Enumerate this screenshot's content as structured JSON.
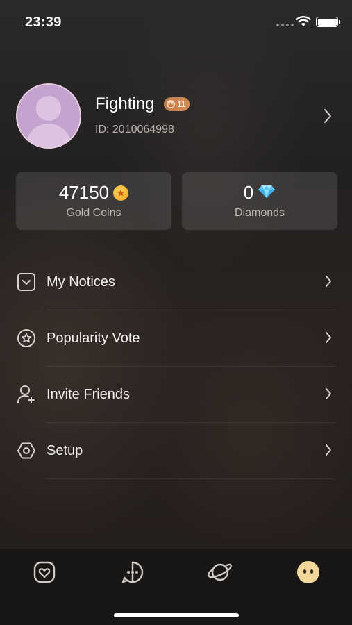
{
  "status_bar": {
    "time": "23:39"
  },
  "profile": {
    "name": "Fighting",
    "level": "11",
    "user_id": "ID: 2010064998"
  },
  "wallet": {
    "gold": {
      "value": "47150",
      "label": "Gold Coins",
      "icon": "coin-icon"
    },
    "diamonds": {
      "value": "0",
      "label": "Diamonds",
      "icon": "diamond-icon"
    }
  },
  "menu": {
    "items": [
      {
        "label": "My Notices",
        "icon": "notice-icon"
      },
      {
        "label": "Popularity Vote",
        "icon": "star-icon"
      },
      {
        "label": "Invite Friends",
        "icon": "add-user-icon"
      },
      {
        "label": "Setup",
        "icon": "settings-icon"
      }
    ]
  },
  "tab_bar": {
    "tabs": [
      {
        "icon": "heart-icon",
        "selected": false
      },
      {
        "icon": "chat-icon",
        "selected": false
      },
      {
        "icon": "planet-icon",
        "selected": false
      },
      {
        "icon": "profile-face-icon",
        "selected": true
      }
    ]
  },
  "colors": {
    "accent_gold": "#f1a51d",
    "badge": "#c07a4a",
    "diamond": "#7fd6ff",
    "selected_tab": "#f3d79a"
  }
}
